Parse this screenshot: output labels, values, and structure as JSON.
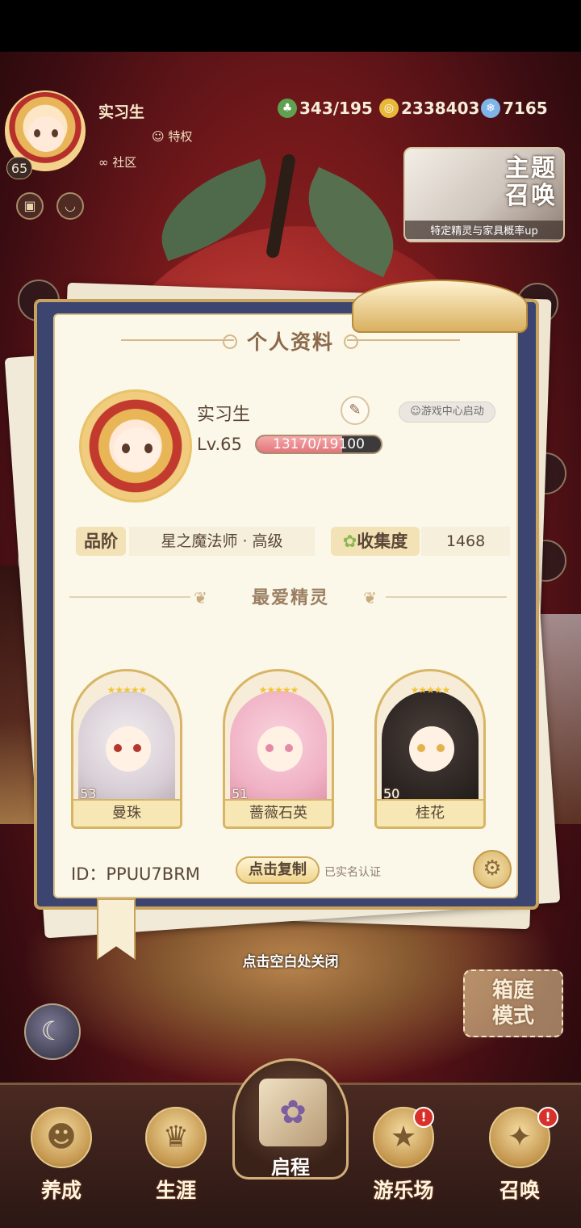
{
  "hud": {
    "player_name": "实习生",
    "level": "65",
    "privilege_label": "特权",
    "community_label": "社区",
    "resources": [
      {
        "icon": "clover-stamina-icon",
        "value": "343/195",
        "color": "#5fa150"
      },
      {
        "icon": "gold-coin-icon",
        "value": "2338403",
        "color": "#e8b83a"
      },
      {
        "icon": "blue-crystal-icon",
        "value": "7165",
        "color": "#7fb4e8"
      }
    ],
    "summon_banner": {
      "title_line1": "主题",
      "title_line2": "召唤",
      "subtitle": "特定精灵与家具概率up"
    }
  },
  "profile": {
    "title": "个人资料",
    "name": "实习生",
    "level_text": "Lv.65",
    "exp_text": "13170/19100",
    "exp_progress": 0.69,
    "launch_button": "游戏中心启动",
    "rank_label": "品阶",
    "rank_value": "星之魔法师 · 高级",
    "collection_label": "收集度",
    "collection_value": "1468",
    "favorites_title": "最爱精灵",
    "favorites": [
      {
        "name": "曼珠",
        "level": "53",
        "stars": "★★★★★",
        "hair_color": "#f1ecef",
        "accent": "#b3362f"
      },
      {
        "name": "蔷薇石英",
        "level": "51",
        "stars": "★★★★★",
        "hair_color": "#f6c4d4",
        "accent": "#e58aa6"
      },
      {
        "name": "桂花",
        "level": "50",
        "stars": "★★★★★",
        "hair_color": "#2e2724",
        "accent": "#e1b34a"
      }
    ],
    "id_text": "ID：PPUU7BRM",
    "copy_button": "点击复制",
    "verified_text": "已实名认证"
  },
  "close_hint": "点击空白处关闭",
  "garden_button": {
    "line1": "箱庭",
    "line2": "模式"
  },
  "bottom_nav": [
    {
      "label": "养成",
      "icon": "character-icon",
      "badge": ""
    },
    {
      "label": "生涯",
      "icon": "crown-icon",
      "badge": ""
    },
    {
      "label": "启程",
      "icon": "book-icon",
      "badge": ""
    },
    {
      "label": "游乐场",
      "icon": "playground-icon",
      "badge": "!"
    },
    {
      "label": "召唤",
      "icon": "summon-card-icon",
      "badge": "!"
    }
  ]
}
